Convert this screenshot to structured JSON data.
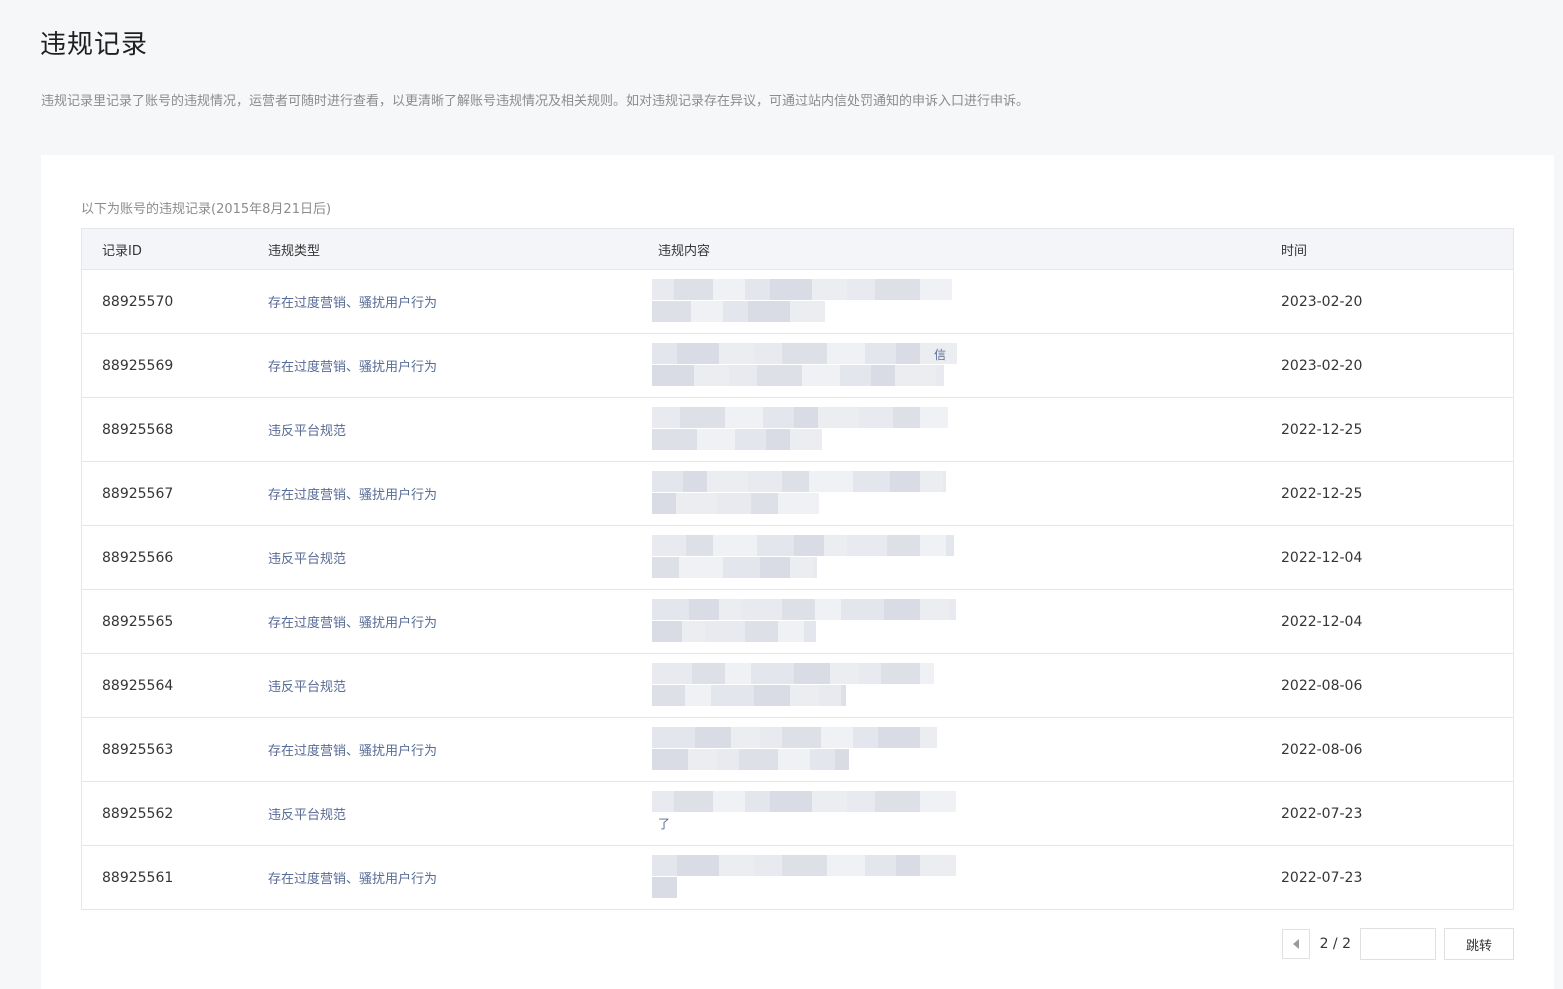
{
  "page": {
    "title": "违规记录",
    "description": "违规记录里记录了账号的违规情况，运营者可随时进行查看，以更清晰了解账号违规情况及相关规则。如对违规记录存在异议，可通过站内信处罚通知的申诉入口进行申诉。"
  },
  "table": {
    "caption": "以下为账号的违规记录(2015年8月21日后)",
    "headers": [
      "记录ID",
      "违规类型",
      "违规内容",
      "时间"
    ],
    "rows": [
      {
        "id": "88925570",
        "type": "存在过度营销、骚扰用户行为",
        "content_tail": "",
        "date": "2023-02-20"
      },
      {
        "id": "88925569",
        "type": "存在过度营销、骚扰用户行为",
        "content_tail": "信",
        "date": "2023-02-20"
      },
      {
        "id": "88925568",
        "type": "违反平台规范",
        "content_tail": "",
        "date": "2022-12-25"
      },
      {
        "id": "88925567",
        "type": "存在过度营销、骚扰用户行为",
        "content_tail": "",
        "date": "2022-12-25"
      },
      {
        "id": "88925566",
        "type": "违反平台规范",
        "content_tail": "",
        "date": "2022-12-04"
      },
      {
        "id": "88925565",
        "type": "存在过度营销、骚扰用户行为",
        "content_tail": "",
        "date": "2022-12-04"
      },
      {
        "id": "88925564",
        "type": "违反平台规范",
        "content_tail": "",
        "date": "2022-08-06"
      },
      {
        "id": "88925563",
        "type": "存在过度营销、骚扰用户行为",
        "content_tail": "",
        "date": "2022-08-06"
      },
      {
        "id": "88925562",
        "type": "违反平台规范",
        "content_tail": "了",
        "date": "2022-07-23"
      },
      {
        "id": "88925561",
        "type": "存在过度营销、骚扰用户行为",
        "content_tail": "",
        "date": "2022-07-23"
      }
    ]
  },
  "pagination": {
    "page_text": "2 / 2",
    "input_value": "",
    "jump_label": "跳转",
    "prev_icon": "caret-left-icon"
  },
  "colors": {
    "background": "#f6f7f9",
    "card": "#ffffff",
    "link": "#576b95",
    "header_bg": "#f4f5f8"
  }
}
